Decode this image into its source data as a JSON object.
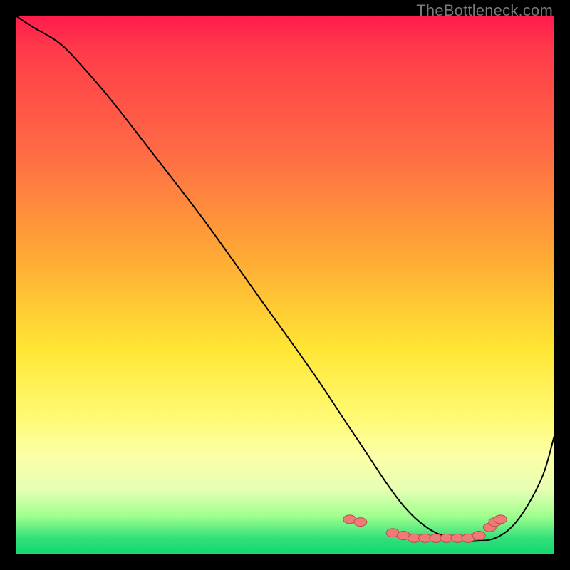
{
  "watermark": "TheBottleneck.com",
  "chart_data": {
    "type": "line",
    "title": "",
    "xlabel": "",
    "ylabel": "",
    "xlim": [
      0,
      100
    ],
    "ylim": [
      0,
      100
    ],
    "series": [
      {
        "name": "bottleneck-curve",
        "x": [
          0,
          3,
          8,
          12,
          18,
          25,
          35,
          45,
          55,
          61,
          65,
          69,
          72,
          75,
          78,
          81,
          83,
          86,
          89,
          92,
          95,
          98,
          100
        ],
        "y": [
          100,
          98,
          95,
          91,
          84,
          75,
          62,
          48,
          34,
          25,
          19,
          13,
          9,
          6,
          4,
          3,
          2.5,
          2.5,
          3,
          5,
          9,
          15,
          22
        ]
      }
    ],
    "markers": {
      "name": "highlight-points",
      "x": [
        62,
        64,
        70,
        72,
        74,
        76,
        78,
        80,
        82,
        84,
        86,
        88,
        89,
        90
      ],
      "y": [
        6.5,
        6,
        4,
        3.5,
        3,
        3,
        3,
        3,
        3,
        3,
        3.5,
        5,
        6,
        6.5
      ],
      "color": "#f07a78",
      "stroke": "#b84b49"
    },
    "line_color": "#000000",
    "line_width": 2
  }
}
